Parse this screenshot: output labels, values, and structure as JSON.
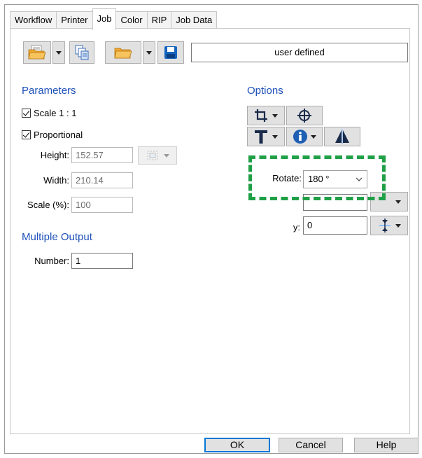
{
  "tabs": [
    {
      "label": "Workflow"
    },
    {
      "label": "Printer"
    },
    {
      "label": "Job"
    },
    {
      "label": "Color"
    },
    {
      "label": "RIP"
    },
    {
      "label": "Job Data"
    }
  ],
  "toolbar": {
    "preset_value": "user defined"
  },
  "parameters": {
    "title": "Parameters",
    "scale_label": "Scale 1 : 1",
    "scale_checked": true,
    "proportional_label": "Proportional",
    "proportional_checked": true,
    "height_label": "Height:",
    "height_value": "152.57",
    "width_label": "Width:",
    "width_value": "210.14",
    "scale_pct_label": "Scale (%):",
    "scale_pct_value": "100"
  },
  "multiple_output": {
    "title": "Multiple Output",
    "number_label": "Number:",
    "number_value": "1"
  },
  "options": {
    "title": "Options",
    "rotate_label": "Rotate:",
    "rotate_value": "180 °",
    "y_label": "y:",
    "y_value": "0"
  },
  "footer": {
    "ok_label": "OK",
    "cancel_label": "Cancel",
    "help_label": "Help"
  },
  "colors": {
    "accent": "#1c4fb8",
    "highlight": "#1fa046",
    "folder": "#f0a830",
    "save": "#1565c0"
  }
}
